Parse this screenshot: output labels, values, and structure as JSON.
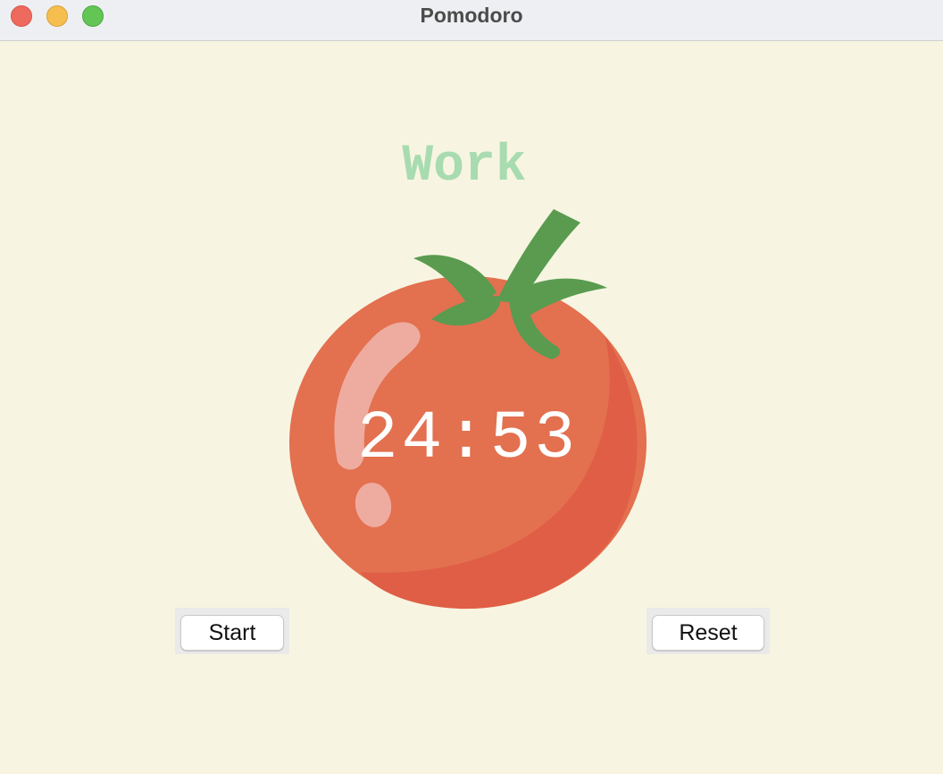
{
  "window": {
    "title": "Pomodoro",
    "controls": [
      "close",
      "minimize",
      "maximize"
    ]
  },
  "timer": {
    "mode": "Work",
    "time": "24:53"
  },
  "buttons": {
    "start_label": "Start",
    "reset_label": "Reset"
  },
  "icons": {
    "tomato": "tomato-icon"
  },
  "colors": {
    "background": "#f7f5e1",
    "mode_label": "#a8dbb0",
    "tomato": "#e3704f",
    "leaves": "#5a9b50"
  }
}
